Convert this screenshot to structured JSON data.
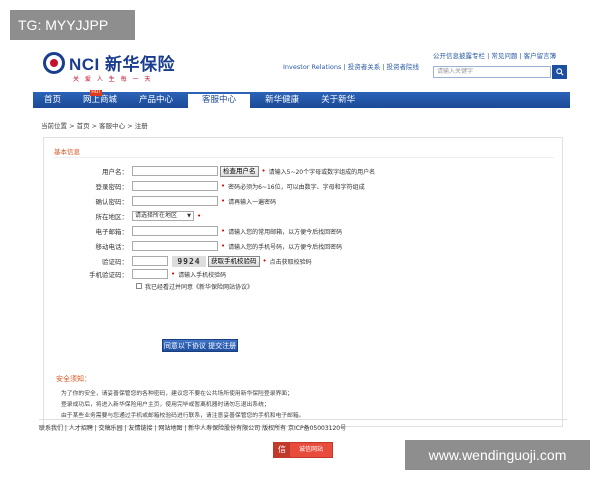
{
  "watermarks": {
    "top_left": "TG: MYYJJPP",
    "bottom_right": "www.wendinguoji.com"
  },
  "header": {
    "logo_text": "NCI 新华保险",
    "slogan": "关 爱 人 生 每 一 天",
    "ir_links": "Investor Relations | 投资者关系 | 投资者院线",
    "top_links": "公开信息披露专栏 | 常见问题 | 客户留言簿",
    "search_placeholder": "请输入关键字",
    "search_icon": "search-icon"
  },
  "nav": {
    "items": [
      "首页",
      "网上商城",
      "产品中心",
      "客服中心",
      "新华健康",
      "关于新华"
    ],
    "active": "客服中心",
    "hot_badge": "HOT"
  },
  "breadcrumb": "当前位置 > 首页 > 客服中心 > 注册",
  "form": {
    "section_title": "基本信息",
    "username_label": "用户名：",
    "check_username_button": "检查用户名",
    "username_hint": "请输入5~20个字母或数字组成的用户名",
    "password_label": "登录密码：",
    "password_hint": "密码必须为6~16位，可以由数字、字母和字符组成",
    "confirm_label": "确认密码：",
    "confirm_hint": "请再输入一遍密码",
    "region_label": "所在地区：",
    "region_select": "请选择所在地区",
    "email_label": "电子邮箱：",
    "email_hint": "请输入您的常用邮箱，以方便今后找回密码",
    "mobile_label": "移动电话：",
    "mobile_hint": "请输入您的手机号码，以方便今后找回密码",
    "captcha_label": "验证码：",
    "captcha_value": "9924",
    "get_sms_button": "获取手机校验码",
    "captcha_hint": "点击获取校验码",
    "sms_label": "手机验证码：",
    "sms_hint": "请输入手机校验码",
    "agree_text": "我已经看过并同意《新华保险网站协议》",
    "submit_button": "同意以下协议 提交注册"
  },
  "notice": {
    "title": "安全须知：",
    "lines": [
      "为了你的安全，请妥善保管您的各种密码，建议您不要在公共场所使用新华保险登录界面；",
      "登录成功后，将进入新华保险用户主页，使用完毕或暂离机器时请勿忘退出系统；",
      "由于某些业务需要与您通过手机或邮箱校验码进行联系，请注意妥善保管您的手机和电子邮箱。"
    ]
  },
  "footer": {
    "links": "联系我们 | 人才招聘 | 交稿乐园 | 友情链接 | 网站地图 | 新华人寿保险股份有限公司 版权所有 京ICP备05003120号",
    "trust_badge": "诚信网站",
    "trust_icon": "信"
  }
}
